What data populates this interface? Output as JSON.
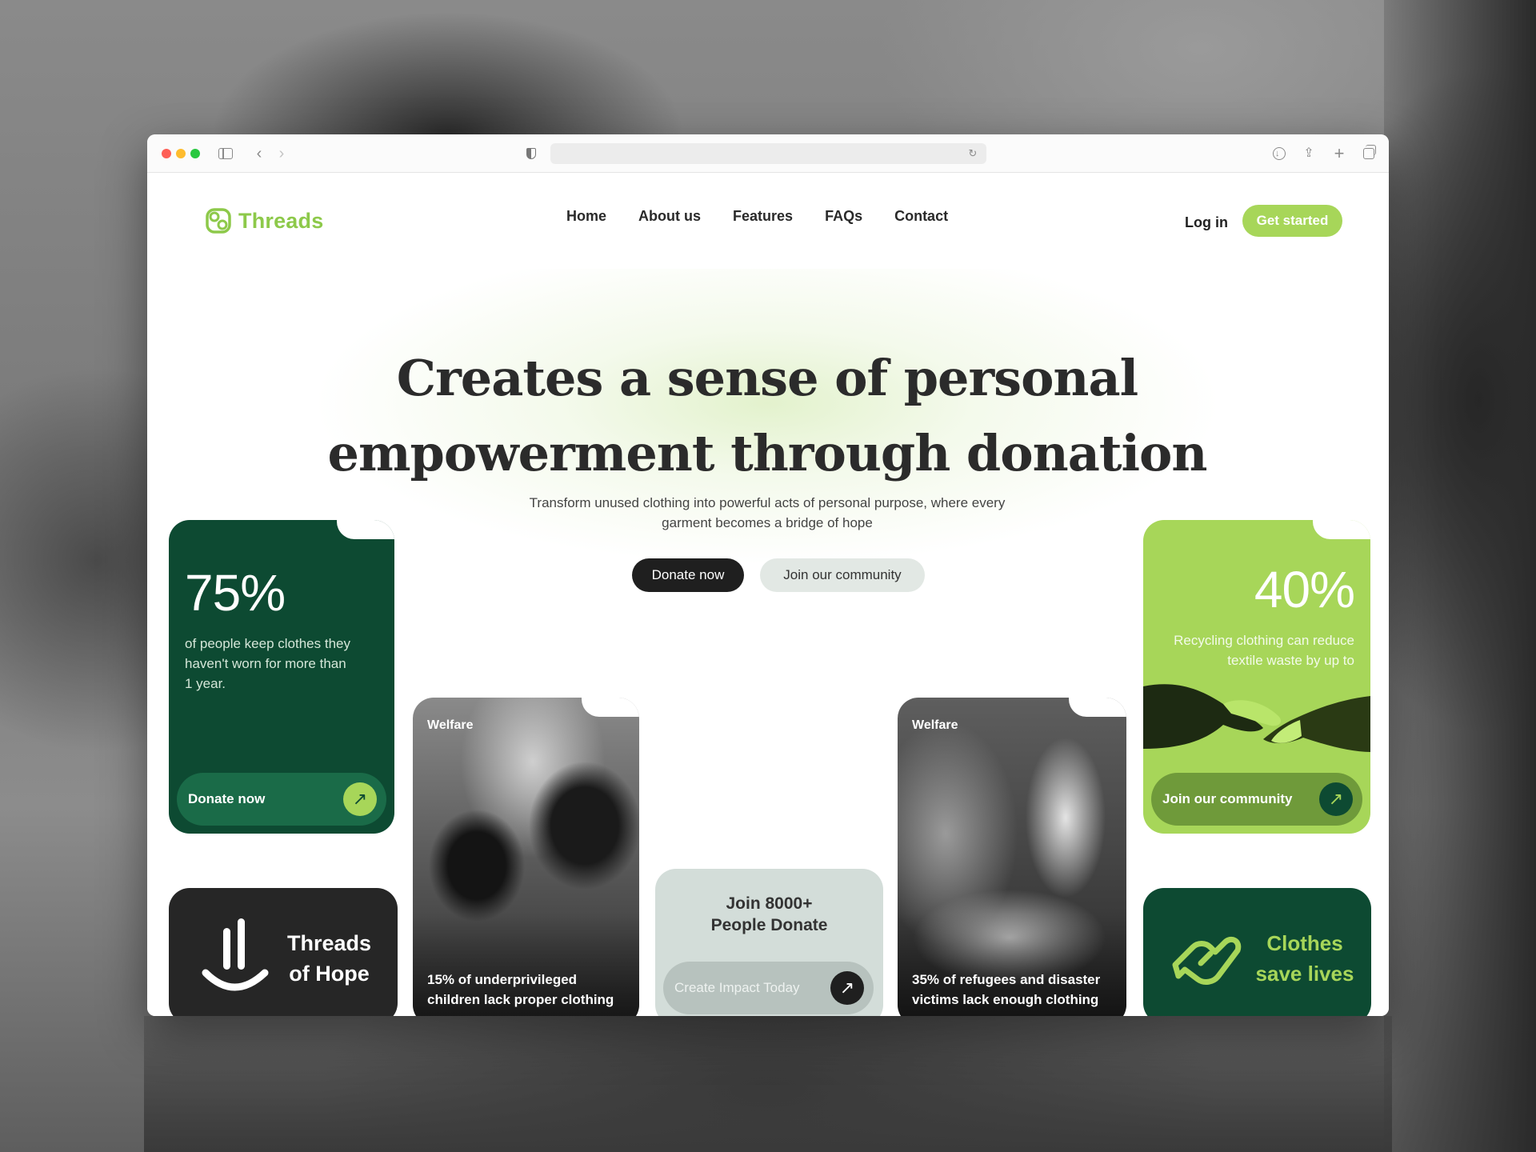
{
  "browser": {
    "url": ""
  },
  "header": {
    "brand_name": "Threads",
    "nav": [
      "Home",
      "About us",
      "Features",
      "FAQs",
      "Contact"
    ],
    "login_label": "Log in",
    "cta_label": "Get started"
  },
  "hero": {
    "title_line1": "Creates a sense of personal",
    "title_line2": "empowerment through donation",
    "subtitle": "Transform unused clothing into powerful acts of personal purpose, where every garment becomes a bridge of hope",
    "primary_button": "Donate now",
    "secondary_button": "Join our community"
  },
  "cards": {
    "stat_left": {
      "value": "75%",
      "text": "of people keep clothes they haven't worn for more than 1 year.",
      "button": "Donate now"
    },
    "brand_card": {
      "line1": "Threads",
      "line2": "of Hope"
    },
    "photo_left": {
      "tag": "Welfare",
      "caption": "15% of underprivileged children lack proper clothing"
    },
    "join_card": {
      "line1": "Join 8000+",
      "line2": "People Donate",
      "button": "Create Impact Today"
    },
    "photo_right": {
      "tag": "Welfare",
      "caption": "35% of refugees and disaster victims lack enough clothing"
    },
    "stat_right": {
      "value": "40%",
      "text": "Recycling clothing can reduce textile waste by up to",
      "button": "Join our community"
    },
    "clothes_card": {
      "line1": "Clothes",
      "line2": "save lives"
    }
  },
  "colors": {
    "brand_green": "#a7d659",
    "dark_green": "#0d4a32",
    "dark": "#1f1f1f"
  },
  "icons": [
    "sidebar-icon",
    "back-icon",
    "forward-icon",
    "shield-icon",
    "reload-icon",
    "download-icon",
    "share-icon",
    "new-tab-icon",
    "tabs-overview-icon",
    "threads-logo-icon",
    "arrow-up-right-icon",
    "smile-icon",
    "heart-hand-icon",
    "hands-image"
  ]
}
